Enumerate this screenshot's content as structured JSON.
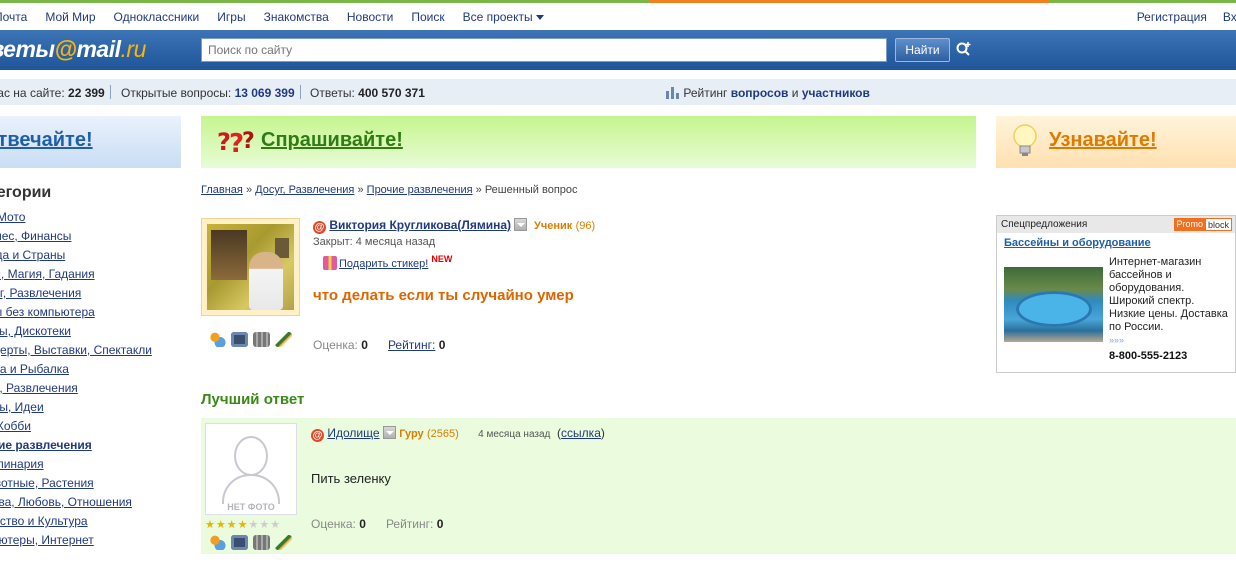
{
  "topnav": {
    "items": [
      "Почта",
      "Мой Мир",
      "Одноклассники",
      "Игры",
      "Знакомства",
      "Новости",
      "Поиск"
    ],
    "all_projects": "Все проекты",
    "register": "Регистрация",
    "login": "Вход"
  },
  "header": {
    "logo_prefix": "Ответы",
    "logo_at": "@",
    "logo_mail": "mail",
    "logo_dot_ru": ".ru",
    "search_placeholder": "Поиск по сайту",
    "search_button": "Найти"
  },
  "stats": {
    "online_label": "Сейчас на сайте:",
    "online_value": "22 399",
    "open_label": "Открытые вопросы:",
    "open_value": "13 069 399",
    "answers_label": "Ответы:",
    "answers_value": "400 570 371",
    "rating_label": "Рейтинг",
    "rating_questions": "вопросов",
    "rating_and": "и",
    "rating_participants": "участников"
  },
  "banners": {
    "answer": "Отвечайте!",
    "ask": "Спрашивайте!",
    "learn": "Узнавайте!"
  },
  "sidebar": {
    "title": "Категории",
    "categories": [
      "Авто, Мото",
      "Бизнес, Финансы",
      "Города и Страны",
      "Гороскопы, Магия, Гадания",
      "Досуг, Развлечения",
      "Игры без компьютера",
      "Клубы, Дискотеки",
      "Концерты, Выставки, Спектакли",
      "Охота и Рыбалка",
      "Праздники, Развлечения",
      "Советы, Идеи",
      "Хобби",
      "Прочие развлечения",
      "Кулинария",
      "Животные, Растения",
      "Знакомства, Любовь, Отношения",
      "Искусство и Культура",
      "Компьютеры, Интернет"
    ]
  },
  "breadcrumb": {
    "home": "Главная",
    "cat": "Досуг, Развлечения",
    "subcat": "Прочие развлечения",
    "current": "Решенный вопрос",
    "sep": "»"
  },
  "question": {
    "author": "Виктория Кругликова(Лямина)",
    "rank": "Ученик",
    "points": "(96)",
    "closed": "Закрыт: 4 месяца назад",
    "sticker": "Подарить стикер!",
    "sticker_new": "NEW",
    "title": "что делать если ты случайно умер",
    "score_label": "Оценка:",
    "score_value": "0",
    "rating_label": "Рейтинг:",
    "rating_value": "0"
  },
  "promo": {
    "header": "Спецпредложения",
    "badge_left": "Promo",
    "badge_right": "block",
    "title": "Бассейны и оборудование",
    "text": "Интернет-магазин бассейнов и оборудования. Широкий спектр. Низкие цены. Доставка по России.",
    "more": "»»»",
    "phone": "8-800-555-2123"
  },
  "best_answer": {
    "title": "Лучший ответ",
    "author": "Идолище",
    "rank": "Гуру",
    "points": "(2565)",
    "time": "4 месяца назад",
    "link": "ссылка",
    "no_photo": "НЕТ ФОТО",
    "stars_filled": 4,
    "stars_total": 7,
    "text": "Пить зеленку",
    "score_label": "Оценка:",
    "score_value": "0",
    "rating_label": "Рейтинг:",
    "rating_value": "0"
  },
  "colors": {
    "brand_blue": "#1f5599",
    "ask_green": "#2f7c12",
    "learn_orange": "#dd7a00",
    "question_orange": "#dd6600",
    "best_answer_green": "#3a8a18"
  }
}
